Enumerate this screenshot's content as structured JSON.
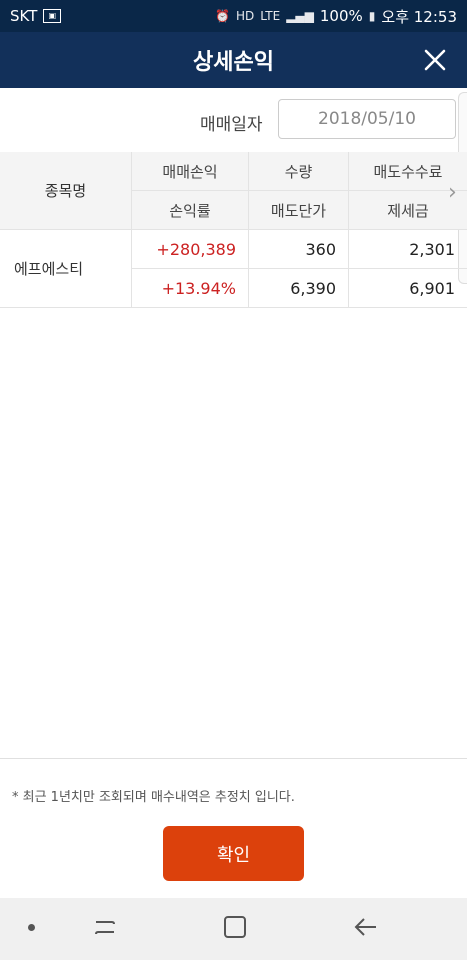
{
  "status_bar": {
    "carrier": "SKT",
    "hd_voice": "HD",
    "lte": "LTE",
    "battery": "100%",
    "time": "오후 12:53"
  },
  "header": {
    "title": "상세손익",
    "close_icon": "close-icon"
  },
  "filter": {
    "date_label": "매매일자",
    "date_value": "2018/05/10"
  },
  "table": {
    "headers": {
      "name": "종목명",
      "row1": [
        "매매손익",
        "수량",
        "매도수수료"
      ],
      "row2": [
        "손익률",
        "매도단가",
        "제세금"
      ]
    },
    "rows": [
      {
        "name": "에프에스티",
        "line1": [
          "+280,389",
          "360",
          "2,301"
        ],
        "line2": [
          "+13.94%",
          "6,390",
          "6,901"
        ]
      }
    ]
  },
  "note": "* 최근 1년치만 조회되며 매수내역은 추정치 입니다.",
  "confirm_label": "확인",
  "colors": {
    "header_bg": "#12305a",
    "status_bg": "#0a2748",
    "profit": "#cc2222",
    "button": "#dc410c"
  }
}
